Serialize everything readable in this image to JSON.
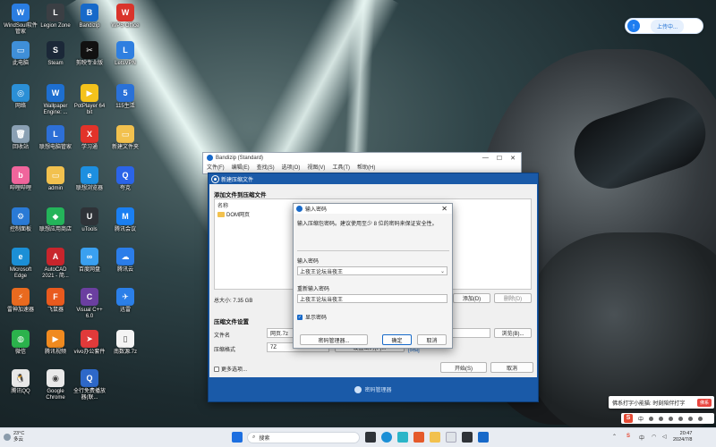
{
  "desktop_icons": [
    {
      "label": "WindSoul软件管家",
      "color": "#2a7de1",
      "glyph": "W"
    },
    {
      "label": "Legion Zone",
      "color": "#3b3f44",
      "glyph": "L"
    },
    {
      "label": "Bandizip",
      "color": "#1769c9",
      "glyph": "B"
    },
    {
      "label": "WPS Office",
      "color": "#d9342b",
      "glyph": "W"
    },
    {
      "label": "此电脑",
      "color": "#3f8fd8",
      "glyph": "▭"
    },
    {
      "label": "Steam",
      "color": "#1b2838",
      "glyph": "S"
    },
    {
      "label": "剪映专业版",
      "color": "#111111",
      "glyph": "✂"
    },
    {
      "label": "LetsVPN",
      "color": "#2f7fe0",
      "glyph": "L"
    },
    {
      "label": "网络",
      "color": "#2b8fd6",
      "glyph": "◎"
    },
    {
      "label": "Wallpaper Engine: ...",
      "color": "#1e6fd0",
      "glyph": "W"
    },
    {
      "label": "PotPlayer 64 bit",
      "color": "#f4c21b",
      "glyph": "▶"
    },
    {
      "label": "115生活",
      "color": "#2a71d8",
      "glyph": "5"
    },
    {
      "label": "回收站",
      "color": "#8aa0b3",
      "glyph": "🗑"
    },
    {
      "label": "联想电脑管家",
      "color": "#2d6fd6",
      "glyph": "L"
    },
    {
      "label": "学习通",
      "color": "#e2332a",
      "glyph": "X"
    },
    {
      "label": "新建文件夹",
      "color": "#f2c14e",
      "glyph": "▭"
    },
    {
      "label": "哔哩哔哩",
      "color": "#f0659c",
      "glyph": "b"
    },
    {
      "label": "admin",
      "color": "#f2c14e",
      "glyph": "▭"
    },
    {
      "label": "联想浏览器",
      "color": "#1d8fe0",
      "glyph": "e"
    },
    {
      "label": "夸克",
      "color": "#2b64e8",
      "glyph": "Q"
    },
    {
      "label": "控制面板",
      "color": "#2a7ad6",
      "glyph": "⚙"
    },
    {
      "label": "联想应用商店",
      "color": "#24b45a",
      "glyph": "◆"
    },
    {
      "label": "uTools",
      "color": "#2f3338",
      "glyph": "U"
    },
    {
      "label": "腾讯会议",
      "color": "#1a7ff2",
      "glyph": "M"
    },
    {
      "label": "Microsoft Edge",
      "color": "#1b8fd6",
      "glyph": "e"
    },
    {
      "label": "AutoCAD 2021 - 简...",
      "color": "#c8252c",
      "glyph": "A"
    },
    {
      "label": "百度网盘",
      "color": "#3aa0f0",
      "glyph": "∞"
    },
    {
      "label": "腾讯云",
      "color": "#2b7de9",
      "glyph": "☁"
    },
    {
      "label": "雷神加速器",
      "color": "#e96a1f",
      "glyph": "⚡"
    },
    {
      "label": "飞鼠器",
      "color": "#e95a1e",
      "glyph": "F"
    },
    {
      "label": "Visual C++ 6.0",
      "color": "#6b3fa0",
      "glyph": "C"
    },
    {
      "label": "迅雷",
      "color": "#2b7fe8",
      "glyph": "✈"
    },
    {
      "label": "微信",
      "color": "#2bb24c",
      "glyph": "◍"
    },
    {
      "label": "腾讯视频",
      "color": "#f08a1f",
      "glyph": "▶"
    },
    {
      "label": "vivo办公套件",
      "color": "#e03a3a",
      "glyph": "➤"
    },
    {
      "label": "南数源.7z",
      "color": "#f4f4f4",
      "glyph": "▯"
    },
    {
      "label": "腾讯QQ",
      "color": "#e8e8e8",
      "glyph": "🐧"
    },
    {
      "label": "Google Chrome",
      "color": "#e9e9e9",
      "glyph": "◉"
    },
    {
      "label": "全行免费播放器(联...",
      "color": "#2e68c8",
      "glyph": "Q"
    }
  ],
  "upload_widget": {
    "icon": "arrow-up-icon",
    "label": "上传中..."
  },
  "bandizip": {
    "title": "Bandizip (Standard)",
    "menu": [
      "文件(F)",
      "编辑(E)",
      "查找(S)",
      "选项(O)",
      "视图(V)",
      "工具(T)",
      "帮助(H)"
    ],
    "controls": [
      "—",
      "☐",
      "✕"
    ]
  },
  "create_archive": {
    "title": "新建压缩文件",
    "heading": "添加文件到压缩文件",
    "list_header": "名称",
    "files": [
      "DOM网页"
    ],
    "total_size": "总大小: 7.35 GB",
    "add_button": "添加(D)",
    "delete_button": "删除(D)",
    "settings_heading": "压缩文件设置",
    "filename_label": "文件名",
    "filename_value": "网页.7z",
    "browse_button": "浏览(B)...",
    "format_label": "压缩格式",
    "format_value": "7Z",
    "set_password_button": "设置密码(P)...",
    "more_options": "更多选项...",
    "start_button": "开始(S)",
    "cancel_button": "取消",
    "footer": "密码管理器",
    "trailing_tag": "[5相]"
  },
  "password_dialog": {
    "title": "输入密码",
    "close": "✕",
    "description": "输入压缩包密码。建议使用至少 8 位的密码来保证安全性。",
    "password_label": "输入密码",
    "password_value": "上夜王论坛当夜王",
    "confirm_label": "重新输入密码",
    "confirm_value": "上夜王论坛当夜王",
    "show_password": "显示密码",
    "manager_button": "密码管理器...",
    "ok_button": "确定",
    "cancel_button": "取消"
  },
  "notification": {
    "text": "佛系打字小能猫: 时刻陪伴打字",
    "tag": "佛系"
  },
  "taskbar": {
    "weather_temp": "23°C",
    "weather_desc": "多云",
    "search_placeholder": "搜索",
    "tray_lang": "中",
    "time": "20:47",
    "date": "2024/7/8"
  }
}
